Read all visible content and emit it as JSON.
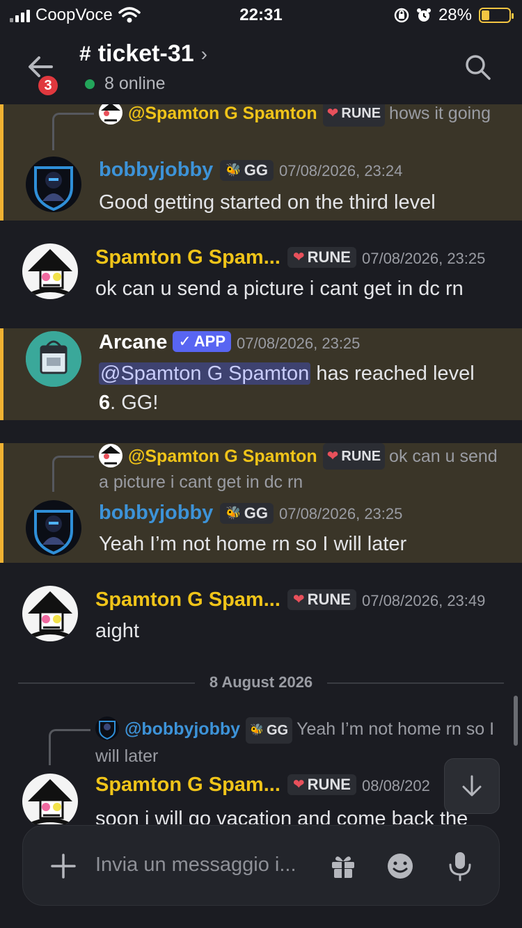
{
  "status": {
    "carrier": "CoopVoce",
    "time": "22:31",
    "battery": "28%",
    "battery_level": 0.28
  },
  "header": {
    "channel": "ticket-31",
    "online": "8 online",
    "badge": "3"
  },
  "messages": [
    {
      "reply": {
        "name": "@Spamton G Spamton",
        "tag": "RUNE",
        "text": "hows it going"
      },
      "author": "bobbyjobby",
      "tag": "GG",
      "timestamp": "07/08/2026, 23:24",
      "text": "Good getting started on the third level"
    },
    {
      "author": "Spamton G Spam...",
      "tag": "RUNE",
      "timestamp": "07/08/2026, 23:25",
      "text": "ok can u send a picture i cant get in dc rn"
    },
    {
      "author": "Arcane",
      "tag": "APP",
      "timestamp": "07/08/2026, 23:25",
      "mention": "@Spamton G Spamton",
      "text_after": " has reached level",
      "level": "6",
      "text_end": ". GG!"
    },
    {
      "reply": {
        "name": "@Spamton G Spamton",
        "tag": "RUNE",
        "text": "ok can u send a picture i cant get in dc rn"
      },
      "author": "bobbyjobby",
      "tag": "GG",
      "timestamp": "07/08/2026, 23:25",
      "text": "Yeah I’m not home rn so I will later"
    },
    {
      "author": "Spamton G Spam...",
      "tag": "RUNE",
      "timestamp": "07/08/2026, 23:49",
      "text": "aight"
    },
    {
      "reply": {
        "name": "@bobbyjobby",
        "tag": "GG",
        "text": "Yeah I’m not home rn so I will later"
      },
      "author": "Spamton G Spam...",
      "tag": "RUNE",
      "timestamp": "08/08/202",
      "text": "soon i will go vacation and come back the"
    }
  ],
  "divider": "8 August 2026",
  "composer": {
    "placeholder": "Invia un messaggio i..."
  },
  "colors": {
    "accent": "#f0b232",
    "highlight_bg": "#3a3528",
    "link_blue": "#3d93d8",
    "name_yellow": "#f0c419",
    "app_badge": "#5865f2"
  }
}
